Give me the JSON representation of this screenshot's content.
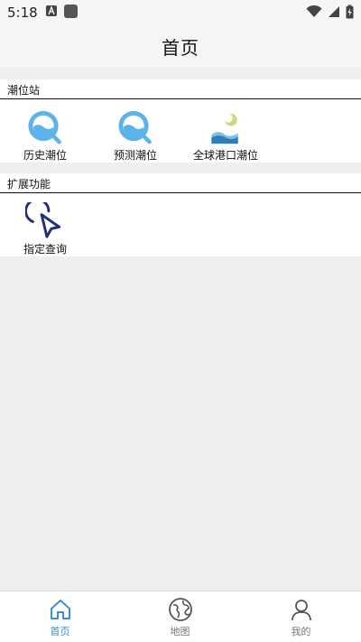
{
  "status_bar": {
    "time": "5:18",
    "icons": [
      "app-a-icon",
      "notification-square-icon",
      "wifi-icon",
      "signal-icon",
      "battery-charging-icon"
    ]
  },
  "header": {
    "title": "首页"
  },
  "sections": [
    {
      "title": "潮位站",
      "items": [
        {
          "label": "历史潮位",
          "icon": "search-water-icon"
        },
        {
          "label": "预测潮位",
          "icon": "search-water-icon"
        },
        {
          "label": "全球港口潮位",
          "icon": "moon-tide-icon"
        }
      ]
    },
    {
      "title": "扩展功能",
      "items": [
        {
          "label": "指定查询",
          "icon": "pointer-click-icon"
        }
      ]
    }
  ],
  "bottom_nav": {
    "items": [
      {
        "label": "首页",
        "icon": "home-icon",
        "active": true
      },
      {
        "label": "地图",
        "icon": "globe-icon",
        "active": false
      },
      {
        "label": "我的",
        "icon": "user-icon",
        "active": false
      }
    ]
  },
  "colors": {
    "accent": "#3b8ed9",
    "icon_blue": "#5cb3ea",
    "pointer_navy": "#1f2f7a",
    "tide_dark": "#2e7fb8",
    "tide_light": "#7cc0e8",
    "moon_green": "#c5dc7a"
  }
}
